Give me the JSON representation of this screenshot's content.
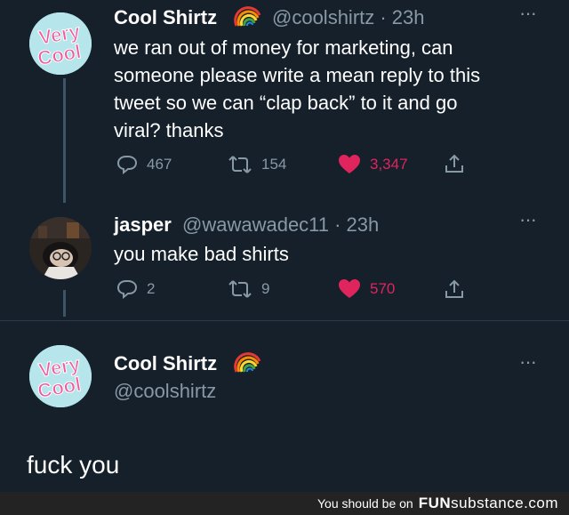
{
  "tweet1": {
    "name": "Cool Shirtz",
    "handle_time": "@coolshirtz · 23h",
    "text": "we ran out of money for marketing, can\nsomeone please write a mean reply to this\ntweet so we can “clap back” to it and go\nviral? thanks",
    "replies": "467",
    "retweets": "154",
    "likes": "3,347"
  },
  "tweet2": {
    "name": "jasper",
    "handle_time": "@wawawadec11 · 23h",
    "text": "you make bad shirts",
    "replies": "2",
    "retweets": "9",
    "likes": "570"
  },
  "tweet3": {
    "name": "Cool Shirtz",
    "handle": "@coolshirtz",
    "text": "fuck you"
  },
  "avatar_logo": {
    "line1": "Very",
    "line2": "Cool"
  },
  "more_menu": "···",
  "watermark": {
    "prefix": "You should be on",
    "brand_main": "FUN",
    "brand_sub": "substance",
    "brand_suffix": ".com"
  },
  "colors": {
    "background": "#15202b",
    "secondary": "#8899a6",
    "like": "#e0245e",
    "logo_pink": "#f05a9e",
    "avatar_bg": "#b6e6ec"
  },
  "icons": [
    "reply-icon",
    "retweet-icon",
    "heart-icon",
    "share-icon",
    "rainbow-emoji",
    "more-icon"
  ]
}
